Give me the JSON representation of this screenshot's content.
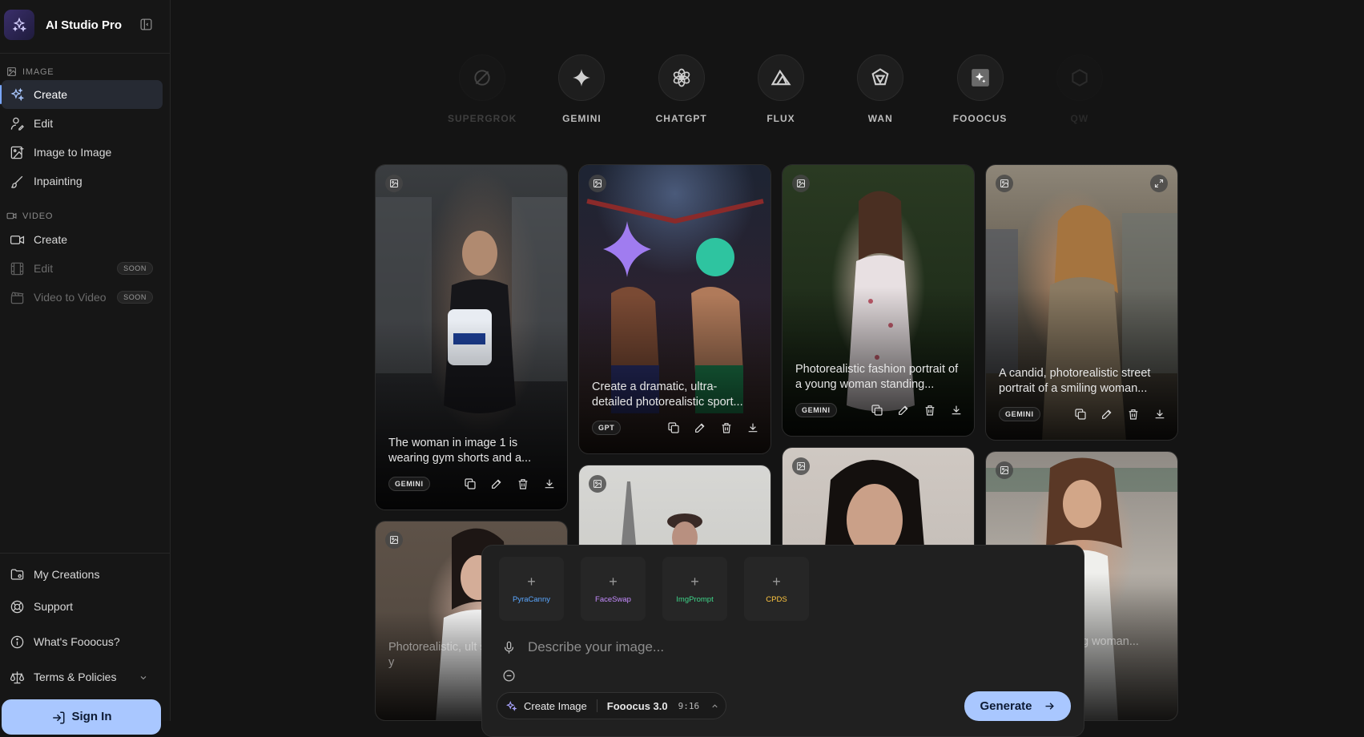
{
  "app": {
    "name": "AI Studio Pro"
  },
  "sidebar": {
    "image_section": "IMAGE",
    "image_items": [
      {
        "label": "Create",
        "active": true
      },
      {
        "label": "Edit"
      },
      {
        "label": "Image to Image"
      },
      {
        "label": "Inpainting"
      }
    ],
    "video_section": "VIDEO",
    "video_items": [
      {
        "label": "Create"
      },
      {
        "label": "Edit",
        "badge": "SOON"
      },
      {
        "label": "Video to Video",
        "badge": "SOON"
      }
    ],
    "bottom_items": [
      {
        "label": "My Creations"
      },
      {
        "label": "Support"
      },
      {
        "label": "What's Fooocus?"
      },
      {
        "label": "Terms & Policies"
      }
    ],
    "signin_label": "Sign In"
  },
  "models": [
    {
      "label": "SUPERGROK",
      "icon": "grok-icon"
    },
    {
      "label": "GEMINI",
      "icon": "gemini-sparkle-icon"
    },
    {
      "label": "CHATGPT",
      "icon": "openai-icon"
    },
    {
      "label": "FLUX",
      "icon": "flux-icon"
    },
    {
      "label": "WAN",
      "icon": "wan-icon"
    },
    {
      "label": "FOOOCUS",
      "icon": "fooocus-icon"
    },
    {
      "label": "QW",
      "icon": "qwen-icon"
    }
  ],
  "gallery": [
    {
      "prompt": "The woman in image 1 is wearing gym shorts and a...",
      "model": "GEMINI"
    },
    {
      "prompt": "Create a dramatic, ultra-detailed photorealistic sport...",
      "model": "GPT"
    },
    {
      "prompt": "Photorealistic fashion portrait of a young woman standing...",
      "model": "GEMINI"
    },
    {
      "prompt": "A candid, photorealistic street portrait of a smiling woman...",
      "model": "GEMINI"
    },
    {
      "prompt": "Photorealistic, ult studio portrait, y",
      "model": ""
    },
    {
      "prompt": "",
      "model": ""
    },
    {
      "prompt": "",
      "model": ""
    },
    {
      "prompt": "ashion portrait ng woman...",
      "model": ""
    }
  ],
  "composer": {
    "tools": [
      {
        "label": "PyraCanny",
        "color": "#5aa7ff"
      },
      {
        "label": "FaceSwap",
        "color": "#c58cff"
      },
      {
        "label": "ImgPrompt",
        "color": "#3fd68a"
      },
      {
        "label": "CPDS",
        "color": "#ffc640"
      }
    ],
    "placeholder": "Describe your image...",
    "mode": "Create Image",
    "engine": "Fooocus 3.0",
    "ratio": "9:16",
    "generate_label": "Generate"
  },
  "colors": {
    "accent": "#a9c7ff",
    "active_bar": "#7aa7ff",
    "background": "#141414"
  }
}
